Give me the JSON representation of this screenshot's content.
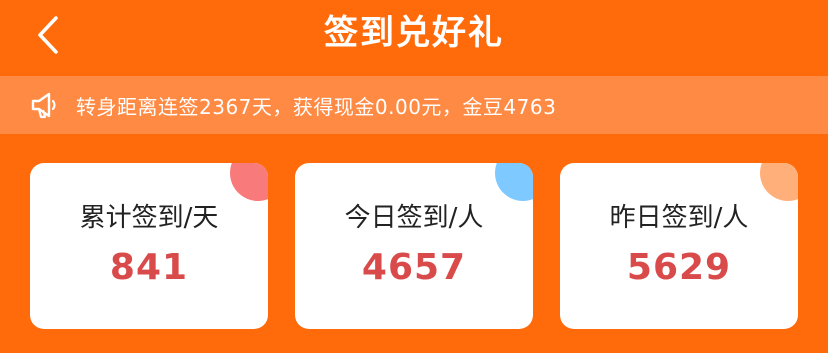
{
  "header": {
    "title": "签到兑好礼"
  },
  "notice": {
    "text": "转身距离连签2367天，获得现金0.00元，金豆4763"
  },
  "stats": [
    {
      "label": "累计签到/天",
      "value": "841",
      "dot_color": "#F97A7A"
    },
    {
      "label": "今日签到/人",
      "value": "4657",
      "dot_color": "#7EC9FF"
    },
    {
      "label": "昨日签到/人",
      "value": "5629",
      "dot_color": "#FFB07A"
    }
  ],
  "colors": {
    "background": "#FF6B0B",
    "notice_bar": "#FE8A44",
    "value_text": "#D94B4B"
  }
}
